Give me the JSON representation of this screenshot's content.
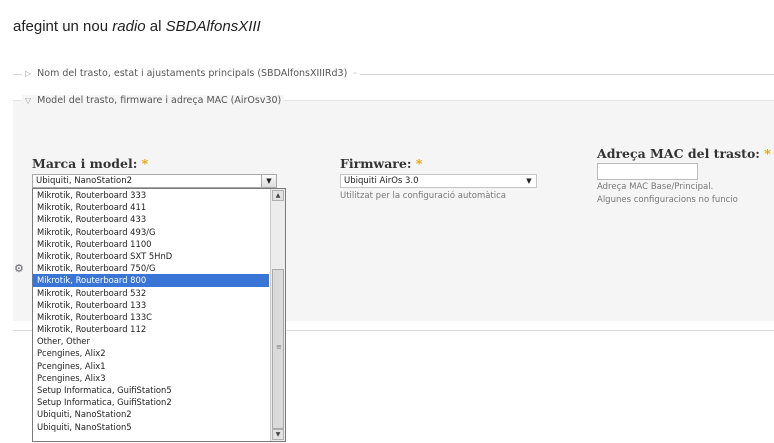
{
  "page": {
    "title_prefix": "afegint un nou",
    "title_italic": "radio",
    "title_mid": "al",
    "title_node": "SBDAlfonsXIII"
  },
  "sections": {
    "main_legend": "Nom del trasto, estat i ajustaments principals (SBDAlfonsXIIIRd3)",
    "model_legend": "Model del trasto, firmware i adreça MAC (AirOsv30)"
  },
  "model_field": {
    "label": "Marca i model:",
    "required_mark": "*",
    "selected": "Ubiquiti, NanoStation2",
    "options": [
      "Mikrotik, Routerboard 333",
      "Mikrotik, Routerboard 411",
      "Mikrotik, Routerboard 433",
      "Mikrotik, Routerboard 493/G",
      "Mikrotik, Routerboard 1100",
      "Mikrotik, Routerboard SXT 5HnD",
      "Mikrotik, Routerboard 750/G",
      "Mikrotik, Routerboard 800",
      "Mikrotik, Routerboard 532",
      "Mikrotik, Routerboard 133",
      "Mikrotik, Routerboard 133C",
      "Mikrotik, Routerboard 112",
      "Other, Other",
      "Pcengines, Alix2",
      "Pcengines, Alix1",
      "Pcengines, Alix3",
      "Setup Informatica, GuifiStation5",
      "Setup Informatica, GuifiStation2",
      "Ubiquiti, NanoStation2",
      "Ubiquiti, NanoStation5"
    ],
    "highlighted_option": "Mikrotik, Routerboard 800"
  },
  "firmware_field": {
    "label": "Firmware:",
    "required_mark": "*",
    "selected": "Ubiquiti AirOs 3.0",
    "hint": "Utilitzat per la configuració automàtica"
  },
  "mac_field": {
    "label": "Adreça MAC del trasto:",
    "required_mark": "*",
    "value": "",
    "hint_line1": "Adreça MAC Base/Principal.",
    "hint_line2": "Algunes configuracions no funcio"
  },
  "colors": {
    "selection": "#3875d7",
    "required": "#e8a000",
    "panel": "#f5f5f5"
  }
}
